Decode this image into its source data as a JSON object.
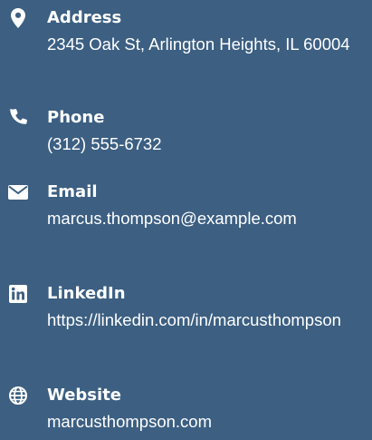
{
  "contacts": [
    {
      "icon": "map-pin-icon",
      "label": "Address",
      "value": "2345 Oak St, Arlington Heights, IL 60004"
    },
    {
      "icon": "phone-icon",
      "label": "Phone",
      "value": "(312) 555-6732"
    },
    {
      "icon": "envelope-icon",
      "label": "Email",
      "value": "marcus.thompson@example.com"
    },
    {
      "icon": "linkedin-icon",
      "label": "LinkedIn",
      "value": "https://linkedin.com/in/marcusthompson"
    },
    {
      "icon": "globe-icon",
      "label": "Website",
      "value": "marcusthompson.com"
    }
  ],
  "colors": {
    "background": "#3c5f82",
    "text": "#ffffff"
  }
}
